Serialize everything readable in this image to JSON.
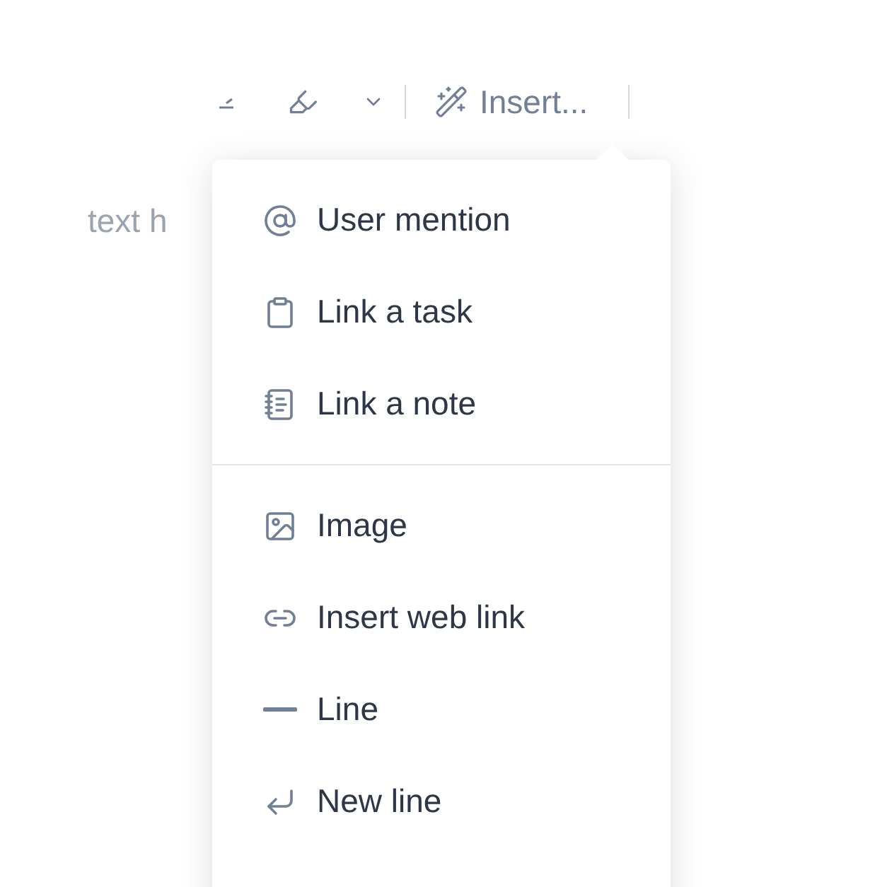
{
  "editor": {
    "text": "text h"
  },
  "toolbar": {
    "insert_label": "Insert..."
  },
  "menu": {
    "groups": [
      {
        "items": [
          "User mention",
          "Link a task",
          "Link a note"
        ]
      },
      {
        "items": [
          "Image",
          "Insert web link",
          "Line",
          "New line"
        ]
      }
    ]
  }
}
